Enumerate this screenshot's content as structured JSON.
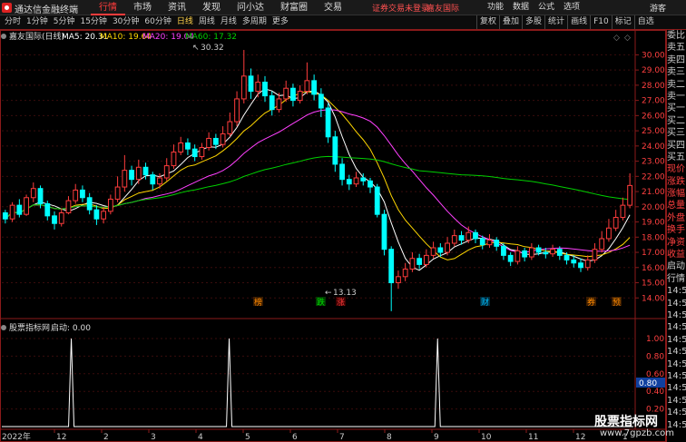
{
  "titlebar": {
    "app_name": "通达信金融终端",
    "nav": [
      "行情",
      "市场",
      "资讯",
      "发现",
      "问小达",
      "财富圈",
      "交易"
    ],
    "status": "证券交易未登录",
    "broker": "嘉友国际",
    "right_menu": [
      "功能",
      "数据",
      "公式",
      "选项"
    ],
    "guest": "游客"
  },
  "toolbar": {
    "periods": [
      "分时",
      "1分钟",
      "5分钟",
      "15分钟",
      "30分钟",
      "60分钟",
      "日线",
      "周线",
      "月线",
      "多周期",
      "更多"
    ],
    "active_period": "日线",
    "tools": [
      "复权",
      "叠加",
      "多股",
      "统计",
      "画线",
      "F10",
      "标记",
      "自选"
    ]
  },
  "chart_header": {
    "stock": "嘉友国际(日线)",
    "ma5": "MA5: 20.31",
    "ma10": "MA10: 19.64",
    "ma20": "MA20: 19.04",
    "ma60": "MA60: 17.32"
  },
  "colors": {
    "up": "#ff3c3c",
    "down": "#00ffff",
    "ma5": "#ffffff",
    "ma10": "#ffd700",
    "ma20": "#ff40ff",
    "ma60": "#00d000",
    "grid": "#8b1a1a"
  },
  "annotations": {
    "high": "30.32",
    "low": "13.13",
    "events": [
      {
        "label": "榜",
        "color": "#ff8a00"
      },
      {
        "label": "跌",
        "color": "#00e000"
      },
      {
        "label": "涨",
        "color": "#ff3c3c"
      },
      {
        "label": "财",
        "color": "#00bfff"
      },
      {
        "label": "券",
        "color": "#ff8a00"
      },
      {
        "label": "预",
        "color": "#ff8a00"
      }
    ]
  },
  "indicator": {
    "name": "股票指标网",
    "value_label": "启动: 0.00",
    "current": "0.80",
    "ticks": [
      "1.00",
      "0.80",
      "0.60",
      "0.40",
      "0.20"
    ]
  },
  "x_axis": {
    "year": "2022年",
    "months": [
      "12",
      "2",
      "3",
      "4",
      "5",
      "6",
      "7",
      "8",
      "9",
      "10",
      "11",
      "12",
      "1"
    ]
  },
  "right_panel": [
    "委比",
    "卖五",
    "卖四",
    "卖三",
    "卖二",
    "卖一",
    "买一",
    "买二",
    "买三",
    "买四",
    "买五",
    "现价",
    "涨跌",
    "涨幅",
    "总量",
    "外盘",
    "换手",
    "净资",
    "收益",
    "启动",
    "行情",
    "14:56",
    "14:56",
    "14:56",
    "14:56",
    "14:56",
    "14:56",
    "14:56",
    "14:56",
    "14:56",
    "14:56",
    "14:56",
    "14:56"
  ],
  "watermark": {
    "line1": "股票指标网",
    "line2": "www.7gpzb.com"
  },
  "chart_data": {
    "type": "candlestick",
    "ylim": [
      13.0,
      30.8
    ],
    "y_ticks": [
      30.0,
      29.0,
      28.0,
      27.0,
      26.0,
      25.0,
      24.0,
      23.0,
      22.0,
      21.0,
      20.0,
      19.0,
      18.0,
      17.0,
      16.0,
      15.0,
      14.0
    ],
    "candles": [
      [
        19.6,
        19.2,
        19.8,
        18.9
      ],
      [
        19.2,
        20.1,
        20.3,
        19.0
      ],
      [
        20.1,
        19.5,
        20.5,
        19.3
      ],
      [
        19.5,
        20.6,
        20.8,
        19.4
      ],
      [
        20.6,
        21.2,
        21.6,
        20.3
      ],
      [
        21.2,
        20.2,
        21.4,
        19.9
      ],
      [
        20.2,
        19.4,
        20.4,
        19.1
      ],
      [
        19.4,
        18.9,
        19.7,
        18.5
      ],
      [
        18.9,
        19.6,
        19.9,
        18.7
      ],
      [
        19.6,
        20.4,
        20.7,
        19.5
      ],
      [
        20.4,
        21.1,
        21.5,
        20.2
      ],
      [
        21.1,
        20.6,
        21.4,
        20.3
      ],
      [
        20.6,
        19.8,
        20.9,
        19.5
      ],
      [
        19.8,
        19.2,
        20.1,
        18.8
      ],
      [
        19.2,
        19.7,
        20.0,
        18.9
      ],
      [
        19.7,
        20.5,
        20.8,
        19.5
      ],
      [
        20.5,
        21.3,
        22.0,
        20.3
      ],
      [
        21.3,
        22.4,
        23.4,
        21.0
      ],
      [
        22.4,
        21.8,
        22.7,
        21.4
      ],
      [
        21.8,
        22.6,
        23.1,
        21.5
      ],
      [
        22.6,
        22.1,
        22.9,
        21.8
      ],
      [
        22.1,
        21.5,
        22.3,
        21.1
      ],
      [
        21.5,
        21.9,
        22.2,
        21.2
      ],
      [
        21.9,
        22.7,
        23.2,
        21.7
      ],
      [
        22.7,
        23.6,
        24.1,
        22.5
      ],
      [
        23.6,
        24.2,
        24.6,
        23.4
      ],
      [
        24.2,
        23.8,
        24.5,
        23.4
      ],
      [
        23.8,
        23.3,
        24.1,
        23.0
      ],
      [
        23.3,
        23.9,
        24.2,
        23.1
      ],
      [
        23.9,
        24.5,
        24.9,
        23.7
      ],
      [
        24.5,
        24.1,
        24.8,
        23.8
      ],
      [
        24.1,
        24.8,
        25.3,
        23.9
      ],
      [
        24.8,
        25.6,
        26.2,
        24.6
      ],
      [
        25.6,
        27.1,
        27.6,
        25.3
      ],
      [
        27.1,
        28.6,
        30.32,
        26.8
      ],
      [
        28.6,
        27.6,
        29.1,
        27.1
      ],
      [
        27.6,
        28.2,
        28.7,
        27.2
      ],
      [
        28.2,
        27.3,
        28.6,
        26.9
      ],
      [
        27.3,
        26.4,
        27.6,
        26.0
      ],
      [
        26.4,
        27.1,
        27.5,
        26.2
      ],
      [
        27.1,
        27.8,
        28.3,
        26.9
      ],
      [
        27.8,
        27.0,
        28.1,
        26.6
      ],
      [
        27.0,
        27.6,
        28.0,
        26.8
      ],
      [
        27.6,
        28.3,
        29.5,
        27.4
      ],
      [
        28.3,
        27.4,
        28.7,
        27.0
      ],
      [
        27.4,
        26.5,
        27.8,
        25.9
      ],
      [
        26.5,
        24.6,
        26.8,
        24.2
      ],
      [
        24.6,
        22.8,
        25.0,
        22.3
      ],
      [
        22.8,
        21.8,
        23.2,
        21.4
      ],
      [
        21.8,
        21.5,
        22.1,
        21.1
      ],
      [
        21.5,
        21.9,
        22.3,
        21.3
      ],
      [
        21.9,
        21.7,
        22.2,
        21.4
      ],
      [
        21.7,
        21.3,
        21.9,
        20.9
      ],
      [
        21.3,
        19.5,
        21.5,
        19.3
      ],
      [
        19.5,
        17.2,
        19.8,
        16.8
      ],
      [
        17.2,
        15.0,
        17.4,
        13.13
      ],
      [
        15.0,
        15.4,
        15.8,
        14.6
      ],
      [
        15.4,
        15.9,
        16.3,
        15.1
      ],
      [
        15.9,
        16.6,
        17.0,
        15.7
      ],
      [
        16.6,
        16.2,
        16.9,
        15.9
      ],
      [
        16.2,
        16.8,
        17.2,
        16.0
      ],
      [
        16.8,
        17.3,
        17.7,
        16.6
      ],
      [
        17.3,
        17.0,
        17.6,
        16.7
      ],
      [
        17.0,
        17.6,
        18.0,
        16.8
      ],
      [
        17.6,
        18.1,
        18.5,
        17.4
      ],
      [
        18.1,
        17.8,
        18.4,
        17.5
      ],
      [
        17.8,
        18.3,
        18.7,
        17.6
      ],
      [
        18.3,
        17.9,
        18.5,
        17.6
      ],
      [
        17.9,
        17.5,
        18.1,
        17.2
      ],
      [
        17.5,
        17.8,
        18.2,
        17.3
      ],
      [
        17.8,
        17.4,
        18.0,
        17.1
      ],
      [
        17.4,
        16.8,
        17.6,
        16.5
      ],
      [
        16.8,
        16.4,
        17.0,
        16.1
      ],
      [
        16.4,
        17.1,
        17.4,
        16.2
      ],
      [
        17.1,
        16.7,
        17.3,
        16.4
      ],
      [
        16.7,
        17.3,
        17.6,
        16.5
      ],
      [
        17.3,
        17.0,
        17.5,
        16.8
      ],
      [
        17.0,
        16.9,
        17.3,
        16.6
      ],
      [
        16.9,
        17.2,
        17.5,
        16.7
      ],
      [
        17.2,
        16.8,
        17.4,
        16.5
      ],
      [
        16.8,
        16.5,
        17.0,
        16.2
      ],
      [
        16.5,
        16.3,
        16.8,
        16.0
      ],
      [
        16.3,
        16.0,
        16.6,
        15.7
      ],
      [
        16.0,
        16.5,
        16.8,
        15.8
      ],
      [
        16.5,
        17.2,
        17.6,
        16.3
      ],
      [
        17.2,
        17.9,
        18.4,
        17.0
      ],
      [
        17.9,
        18.6,
        19.2,
        17.7
      ],
      [
        18.6,
        19.3,
        19.8,
        18.4
      ],
      [
        19.3,
        20.1,
        20.6,
        19.1
      ],
      [
        20.1,
        21.4,
        22.2,
        19.9
      ]
    ],
    "spikes": [
      0.11,
      0.36,
      0.69
    ]
  }
}
